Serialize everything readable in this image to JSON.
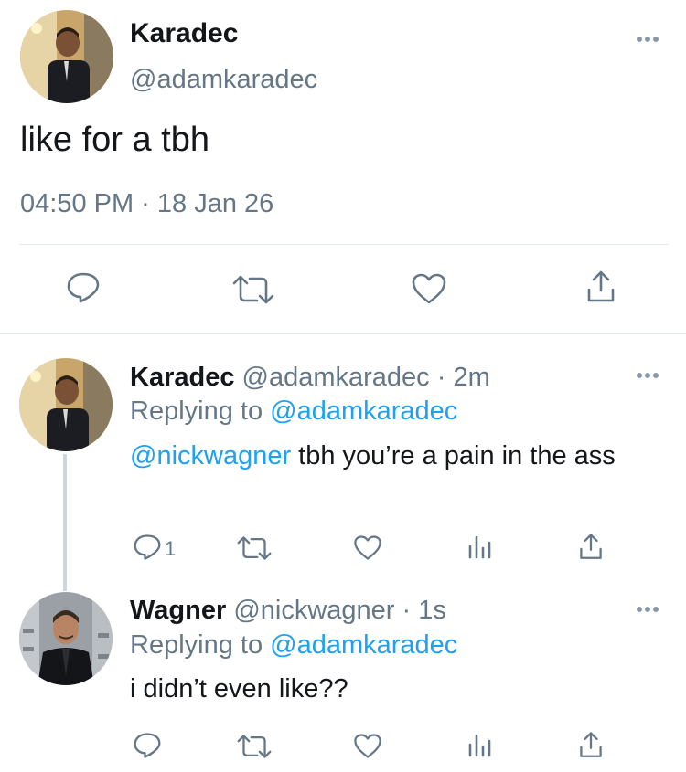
{
  "main_tweet": {
    "name": "Karadec",
    "handle": "@adamkaradec",
    "text": "like for a tbh",
    "meta": "04:50 PM · 18 Jan 26",
    "actions": [
      "reply-icon",
      "retweet-icon",
      "like-icon",
      "share-icon"
    ]
  },
  "replies": [
    {
      "name": "Karadec",
      "handle": "@adamkaradec",
      "time": "· 2m",
      "replying_prefix": "Replying to ",
      "replying_to": "@adamkaradec",
      "mention": "@nickwagner",
      "text": " tbh you’re a pain in the ass",
      "reply_count": "1"
    },
    {
      "name": "Wagner",
      "handle": "@nickwagner",
      "time": "· 1s",
      "replying_prefix": "Replying to ",
      "replying_to": "@adamkaradec",
      "text": "i didn’t even like??"
    }
  ],
  "colors": {
    "accent": "#1da1f2",
    "muted": "#657786",
    "icon": "#657786",
    "divider": "#e1e8ed"
  }
}
